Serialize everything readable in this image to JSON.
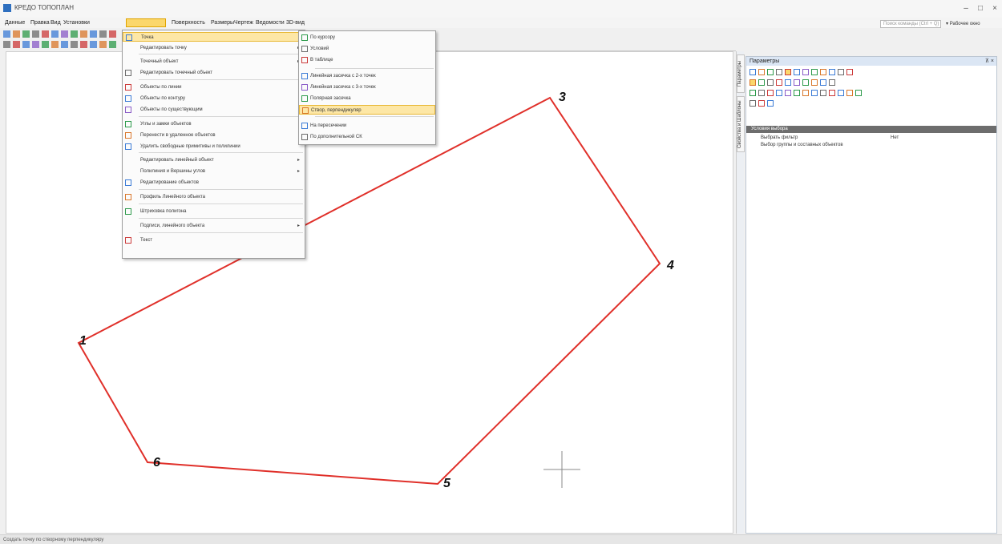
{
  "app": {
    "title": "КРЕДО ТОПОПЛАН"
  },
  "window_controls": {
    "minimize": "–",
    "maximize": "□",
    "close": "×"
  },
  "menubar": {
    "items": [
      "Данные",
      "Правка",
      "Вид",
      "Установки",
      "",
      "Поверхность",
      "Размеры",
      "Чертеж",
      "Ведомости",
      "3D-вид"
    ],
    "search_placeholder": "Поиск команды (Ctrl + Q)",
    "workspace": "Рабочее окно"
  },
  "main_menu": {
    "items": [
      {
        "label": "Точка",
        "icon": "point-icon",
        "submenu": true
      },
      {
        "label": "Редактировать точку",
        "icon": "none",
        "submenu": true
      },
      {
        "label": "Точечный объект",
        "icon": "none",
        "submenu": true
      },
      {
        "label": "Редактировать точечный объект",
        "icon": "edit-icon",
        "submenu": false
      },
      {
        "label": "Объекты по линии",
        "icon": "line-objects-icon",
        "submenu": false
      },
      {
        "label": "Объекты по контуру",
        "icon": "contour-objects-icon",
        "submenu": false
      },
      {
        "label": "Объекты по существующим",
        "icon": "existing-objects-icon",
        "submenu": false
      },
      {
        "label": "Углы и замки объектов",
        "icon": "angles-icon",
        "submenu": false
      },
      {
        "label": "Перенести в удаленное объектов",
        "icon": "move-icon",
        "submenu": false
      },
      {
        "label": "Удалить свободные примитивы и полилинии",
        "icon": "delete-icon",
        "submenu": false
      },
      {
        "label": "Редактировать линейный объект",
        "icon": "none",
        "submenu": true
      },
      {
        "label": "Полилиния и Вершины углов",
        "icon": "none",
        "submenu": true
      },
      {
        "label": "Редактирование объектов",
        "icon": "edit-objects-icon",
        "submenu": false
      },
      {
        "label": "Профиль Линейного объекта",
        "icon": "profile-icon",
        "submenu": false
      },
      {
        "label": "Штриховка полигона",
        "icon": "hatch-icon",
        "submenu": false
      },
      {
        "label": "Подписи, линейного объекта",
        "icon": "none",
        "submenu": true
      },
      {
        "label": "Текст",
        "icon": "text-icon",
        "submenu": false
      }
    ]
  },
  "submenu": {
    "items": [
      {
        "label": "По курсору",
        "icon": "cursor-point-icon"
      },
      {
        "label": "Условий",
        "icon": "condition-icon"
      },
      {
        "label": "В таблице",
        "icon": "table-icon"
      },
      {
        "label": "Линейная засечка с 2-х точек",
        "icon": "linear-resection-icon"
      },
      {
        "label": "Линейная засечка с 3-х точек",
        "icon": "linear-resection3-icon"
      },
      {
        "label": "Полярная засечка",
        "icon": "polar-icon"
      },
      {
        "label": "Створ, перпендикуляр",
        "icon": "alignment-icon"
      },
      {
        "label": "На пересечении",
        "icon": "intersection-icon"
      },
      {
        "label": "По дополнительной СК",
        "icon": "coord-system-icon"
      }
    ],
    "highlighted_index": 6
  },
  "polygon": {
    "points": [
      {
        "label": "1"
      },
      {
        "label": "3"
      },
      {
        "label": "4"
      },
      {
        "label": "5"
      },
      {
        "label": "6"
      }
    ],
    "line_color": "#e0302a"
  },
  "side_tabs": [
    "Параметры",
    "Свойства и Шаблоны"
  ],
  "panel": {
    "title": "Параметры",
    "pin": "⊼ ×",
    "section": "Условия выбора",
    "properties": [
      {
        "label": "Выбрать фильтр",
        "value": "Нет"
      },
      {
        "label": "Выбор группы и составных объектов",
        "value": ""
      }
    ]
  },
  "status": {
    "text": "Создать точку по створному перпендикуляру"
  },
  "colors": {
    "accent": "#fbd76b",
    "polygon": "#e0302a",
    "panel_header": "#dbe6f4",
    "section": "#6d6d6d"
  }
}
